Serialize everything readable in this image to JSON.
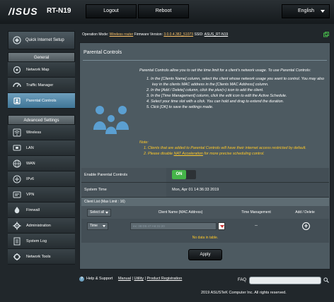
{
  "header": {
    "logo": "/ISUS",
    "model": "RT-N19",
    "logout_label": "Logout",
    "reboot_label": "Reboot",
    "language": "English"
  },
  "status": {
    "op_mode_label": "Operation Mode:",
    "op_mode_value": "Wireless router",
    "firmware_label": "Firmware Version:",
    "firmware_value": "3.0.0.4.382_51073",
    "ssid_label": "SSID:",
    "ssid_value": "ASUS_RT-N19"
  },
  "sidebar": {
    "quick_setup": "Quick Internet Setup",
    "general_header": "General",
    "general_items": [
      {
        "label": "Network Map",
        "icon": "network-map-icon"
      },
      {
        "label": "Traffic Manager",
        "icon": "traffic-manager-icon"
      },
      {
        "label": "Parental Controls",
        "icon": "parental-controls-icon",
        "active": true
      }
    ],
    "advanced_header": "Advanced Settings",
    "advanced_items": [
      {
        "label": "Wireless",
        "icon": "wireless-icon"
      },
      {
        "label": "LAN",
        "icon": "lan-icon"
      },
      {
        "label": "WAN",
        "icon": "wan-icon"
      },
      {
        "label": "IPv6",
        "icon": "ipv6-icon"
      },
      {
        "label": "VPN",
        "icon": "vpn-icon"
      },
      {
        "label": "Firewall",
        "icon": "firewall-icon"
      },
      {
        "label": "Administration",
        "icon": "administration-icon"
      },
      {
        "label": "System Log",
        "icon": "system-log-icon"
      },
      {
        "label": "Network Tools",
        "icon": "network-tools-icon"
      }
    ]
  },
  "main": {
    "title": "Parental Controls",
    "intro": "Parental Controls allow you to set the time limit for a client's network usage. To use Parental Controls:",
    "steps": [
      "1. In the [Clients Name] column, select the client whose network usage you want to control. You may also key in the clients MAC address in the [Clients MAC Address] column.",
      "2. In the [Add / Delete] column, click the plus(+) icon to add the client.",
      "3. In the [Time Management] column, click the edit icon to edit the Active Schedule.",
      "4. Select your time slot with a click. You can hold and drag to extend the duration.",
      "5. Click [OK] to save the settings made."
    ],
    "note_label": "Note:",
    "note_1": "1. Clients that are added to Parental Controls will have their internet access restricted by default.",
    "note_2_prefix": "2. Please disable ",
    "note_2_link": "NAT Acceleration",
    "note_2_suffix": " for more precise scheduling control.",
    "enable_label": "Enable Parental Controls",
    "enable_value": "ON",
    "system_time_label": "System Time",
    "system_time_value": "Mon, Apr 01 14:36:33 2019",
    "client_list_label": "Client List (Max Limit : 16)",
    "col_select": "Select all",
    "col_client": "Client Name (MAC Address)",
    "col_time": "Time Management",
    "col_add": "Add / Delete",
    "mode_select": "Time",
    "mac_placeholder": "ex: 38:D5:47:A6:31:20",
    "time_value": "--",
    "no_data": "No data in table.",
    "apply_label": "Apply"
  },
  "footer": {
    "help": "Help & Support",
    "manual": "Manual",
    "utility": "Utility",
    "registration": "Product Registration",
    "faq": "FAQ",
    "copyright": "2019 ASUSTeK Computer Inc. All rights reserved."
  }
}
